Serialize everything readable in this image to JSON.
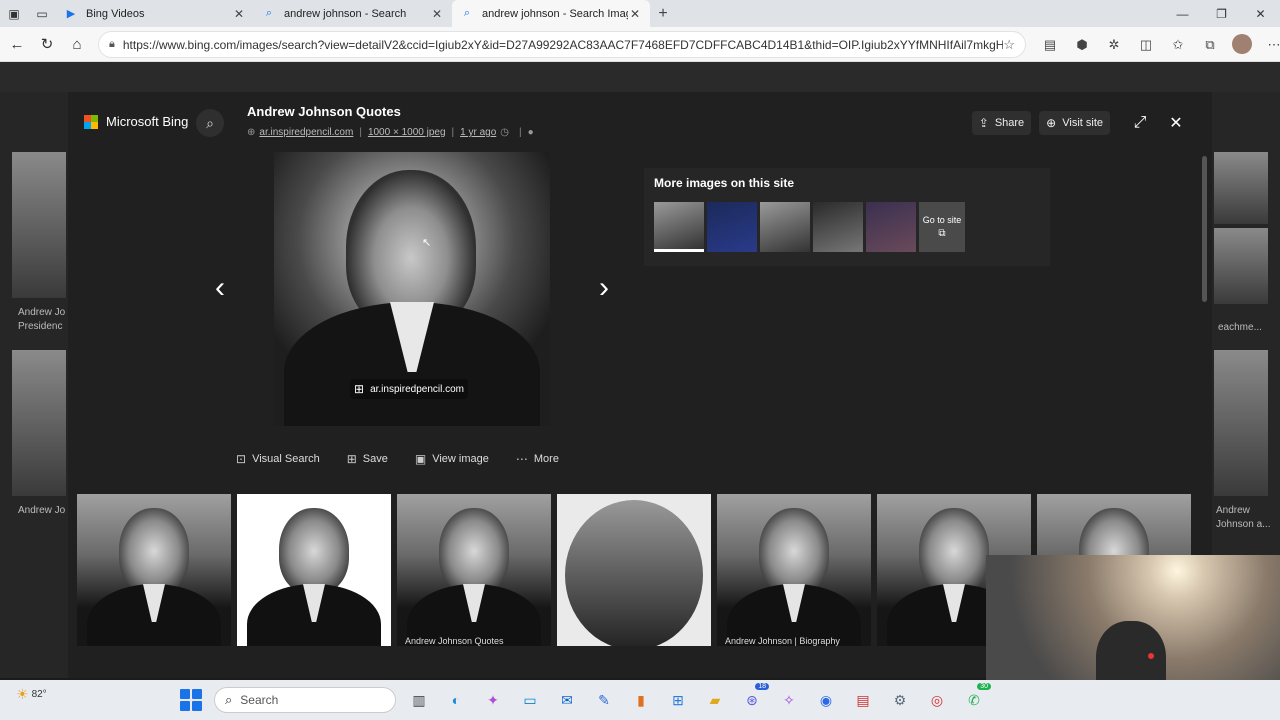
{
  "browser": {
    "tabs": [
      {
        "title": "Bing Videos",
        "active": false
      },
      {
        "title": "andrew johnson - Search",
        "active": false
      },
      {
        "title": "andrew johnson - Search Images",
        "active": true
      }
    ],
    "new_tab": "+",
    "url": "https://www.bing.com/images/search?view=detailV2&ccid=Igiub2xY&id=D27A99292AC83AAC7F7468EFD7CDFFCABC4D14B1&thid=OIP.Igiub2xYYfMNHIfAil7mkgHaHa&..."
  },
  "background_page": {
    "left_labels": [
      "Andrew Jo",
      "Presidenc",
      "Andrew Jo"
    ],
    "right_labels": [
      "eachme...",
      "Andrew",
      "Johnson a..."
    ]
  },
  "modal": {
    "brand": "Microsoft Bing",
    "title": "Andrew Johnson Quotes",
    "meta": {
      "site": "ar.inspiredpencil.com",
      "size": "1000 × 1000 jpeg",
      "age": "1 yr ago"
    },
    "share_label": "Share",
    "visit_label": "Visit site",
    "source_chip": "ar.inspiredpencil.com",
    "actions": {
      "visual_search": "Visual Search",
      "save": "Save",
      "view_image": "View image",
      "more": "More"
    },
    "more_images": {
      "heading": "More images on this site",
      "goto_label": "Go to site"
    },
    "related_captions": [
      "",
      "",
      "Andrew Johnson Quotes",
      "",
      "Andrew Johnson | Biography",
      "",
      ""
    ]
  },
  "taskbar": {
    "weather_temp": "82°",
    "search_placeholder": "Search",
    "badge_teams": "18",
    "badge_whatsapp": "30"
  }
}
